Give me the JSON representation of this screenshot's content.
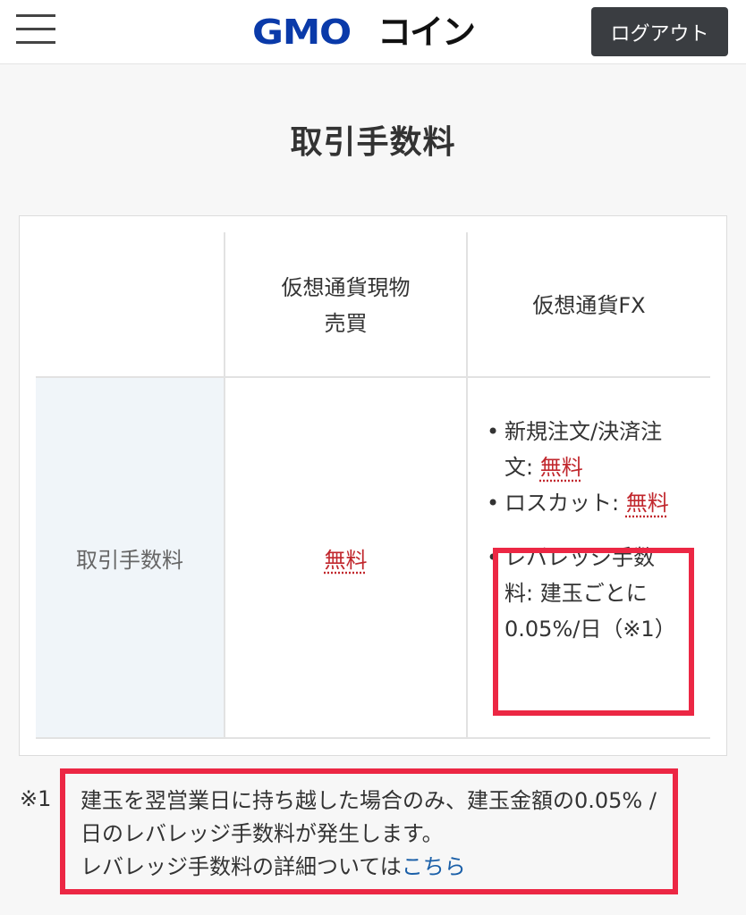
{
  "header": {
    "menu_icon": "hamburger-menu-icon",
    "logo_brand": "GMO",
    "logo_suffix": "コイン",
    "logout_label": "ログアウト",
    "colors": {
      "logo_blue": "#0a3aa9",
      "button_bg": "#3a3d41"
    }
  },
  "title": "取引手数料",
  "table": {
    "columns": [
      "仮想通貨現物\n売買",
      "仮想通貨FX"
    ],
    "row_label": "取引手数料",
    "spot_fee": "無料",
    "fx_items": [
      {
        "label": "新規注文/決済注文: ",
        "value": "無料"
      },
      {
        "label": "ロスカット: ",
        "value": "無料"
      },
      {
        "label": "レバレッジ手数料: 建玉ごとに0.05%/日（※1）",
        "value": ""
      }
    ]
  },
  "footnote": {
    "mark": "※1",
    "line1": "建玉を翌営業日に持ち越した場合のみ、建玉金額の0.05% / 日のレバレッジ手数料が発生します。",
    "line2_prefix": "レバレッジ手数料の詳細ついては",
    "link_text": "こちら"
  },
  "colors": {
    "fee_red": "#c1272d",
    "highlight": "#ec2744",
    "link": "#1a5fa8",
    "row_head_bg": "#f0f5f9"
  }
}
